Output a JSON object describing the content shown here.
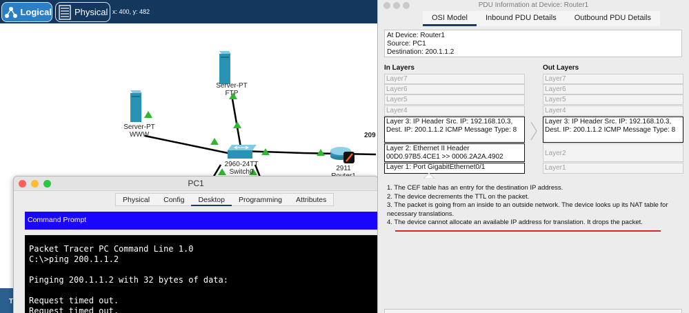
{
  "toolbar": {
    "logical_label": "Logical",
    "physical_label": "Physical",
    "coords": "x: 400, y: 482"
  },
  "topology": {
    "server_ftp": {
      "name": "Server-PT",
      "sub": "FTP"
    },
    "server_www": {
      "name": "Server-PT",
      "sub": "WWW"
    },
    "switch": {
      "model": "2960-24TT",
      "name": "Switch0"
    },
    "router": {
      "model": "2911",
      "name": "Router1"
    },
    "partial_label": "209",
    "strip_letter": "T"
  },
  "pc1": {
    "title": "PC1",
    "tabs": [
      "Physical",
      "Config",
      "Desktop",
      "Programming",
      "Attributes"
    ],
    "active_tab": "Desktop",
    "cmd_title": "Command Prompt",
    "lines": [
      "Packet Tracer PC Command Line 1.0",
      "C:\\>ping 200.1.1.2",
      "",
      "Pinging 200.1.1.2 with 32 bytes of data:",
      "",
      "Request timed out.",
      "Request timed out."
    ]
  },
  "pdu": {
    "title": "PDU Information at Device: Router1",
    "tabs": [
      "OSI Model",
      "Inbound PDU Details",
      "Outbound PDU Details"
    ],
    "active_tab": "OSI Model",
    "device": "At Device: Router1",
    "source": "Source: PC1",
    "destination": "Destination: 200.1.1.2",
    "in_heading": "In Layers",
    "out_heading": "Out Layers",
    "in_layers": {
      "l7": "Layer7",
      "l6": "Layer6",
      "l5": "Layer5",
      "l4": "Layer4",
      "l3": "Layer 3: IP Header Src. IP: 192.168.10.3, Dest. IP: 200.1.1.2 ICMP Message Type: 8",
      "l2": "Layer 2: Ethernet II Header 00D0.97B5.4CE1 >> 0006.2A2A.4902",
      "l1": "Layer 1: Port GigabitEthernet0/1"
    },
    "out_layers": {
      "l7": "Layer7",
      "l6": "Layer6",
      "l5": "Layer5",
      "l4": "Layer4",
      "l3": "Layer 3: IP Header Src. IP: 192.168.10.3, Dest. IP: 200.1.1.2 ICMP Message Type: 8",
      "l2": "Layer2",
      "l1": "Layer1"
    },
    "notes": [
      "1. The CEF table has an entry for the destination IP address.",
      "2. The device decrements the TTL on the packet.",
      "3. The packet is going from an inside to an outside network. The device looks up its NAT table for necessary translations.",
      "4. The device cannot allocate an available IP address for translation. It drops the packet."
    ]
  },
  "colors": {
    "titlebar": "#14375e",
    "logical_active": "#2b7fc4",
    "link_up": "#2eb82e",
    "cmd_bar": "#1a05ff",
    "highlight_line": "#d9251c"
  }
}
